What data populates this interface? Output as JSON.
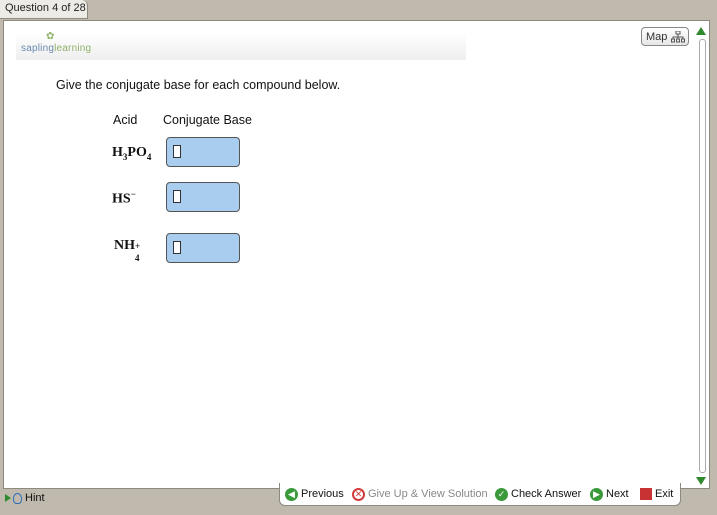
{
  "header": {
    "question_tab": "Question 4 of 28"
  },
  "logo": {
    "part1": "sapling",
    "part2": "learning"
  },
  "map_button": {
    "label": "Map"
  },
  "question": {
    "prompt": "Give the conjugate base for each compound below."
  },
  "table": {
    "col_acid": "Acid",
    "col_base": "Conjugate Base",
    "rows": [
      {
        "formula_main": "H",
        "sub1": "3",
        "mid": "PO",
        "sub2": "4",
        "sup": ""
      },
      {
        "formula_main": "HS",
        "sub1": "",
        "mid": "",
        "sub2": "",
        "sup": "−"
      },
      {
        "formula_main": "NH",
        "sub1": "",
        "mid": "",
        "sub2": "4",
        "sup": "+"
      }
    ],
    "answers": [
      "",
      "",
      ""
    ]
  },
  "footer": {
    "hint": "Hint",
    "previous": "Previous",
    "give_up": "Give Up & View Solution",
    "check": "Check Answer",
    "next": "Next",
    "exit": "Exit"
  },
  "colors": {
    "answer_box": "#a9cdef",
    "accent_green": "#3a9a3a",
    "danger_red": "#d23b3b"
  }
}
